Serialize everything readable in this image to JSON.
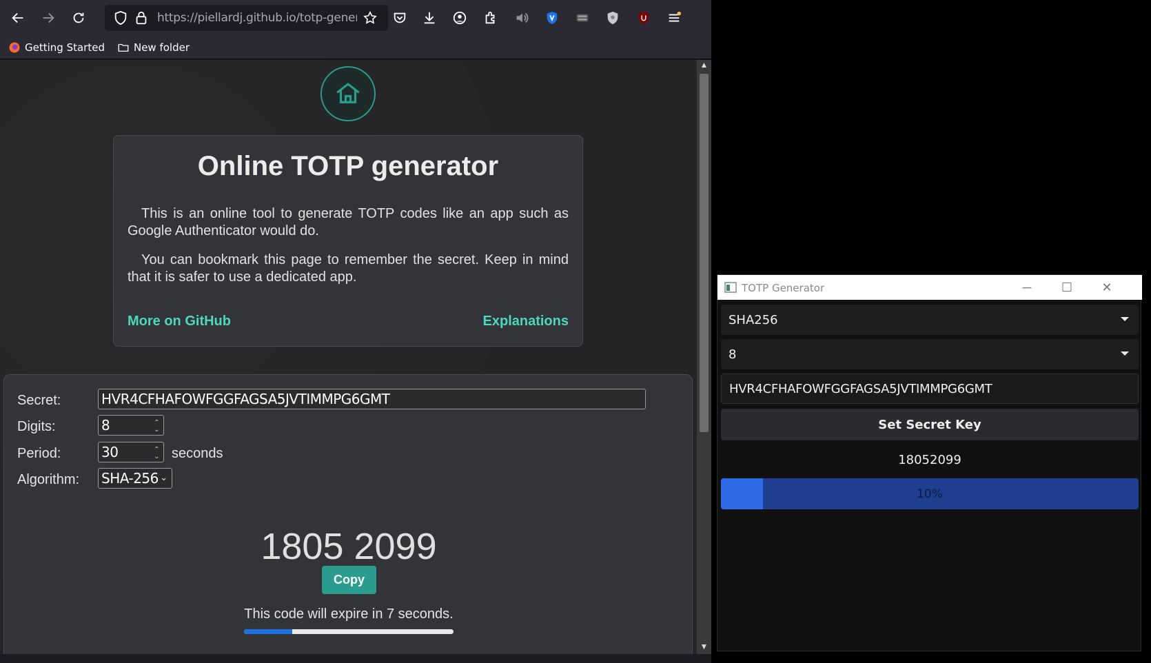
{
  "browser": {
    "url_host": "https://piellardj.github.io",
    "url_path": "/totp-generat",
    "bookmarks": [
      {
        "label": "Getting Started"
      },
      {
        "label": "New folder"
      }
    ]
  },
  "page": {
    "intro": {
      "title": "Online TOTP generator",
      "paragraph1": "This is an online tool to generate TOTP codes like an app such as Google Authenticator would do.",
      "paragraph2": "You can bookmark this page to remember the secret. Keep in mind that it is safer to use a dedicated app.",
      "github_link": "More on GitHub",
      "explanations_link": "Explanations"
    },
    "form": {
      "secret_label": "Secret:",
      "secret_value": "HVR4CFHAFOWFGGFAGSA5JVTIMMPG6GMT",
      "digits_label": "Digits:",
      "digits_value": "8",
      "period_label": "Period:",
      "period_value": "30",
      "period_unit": "seconds",
      "algorithm_label": "Algorithm:",
      "algorithm_value": "SHA-256"
    },
    "code": "1805 2099",
    "copy_label": "Copy",
    "expire_text": "This code will expire in 7 seconds.",
    "expire_progress_fraction": 0.23
  },
  "app": {
    "title": "TOTP Generator",
    "algorithm": "SHA256",
    "digits": "8",
    "secret": "HVR4CFHAFOWFGGFAGSA5JVTIMMPG6GMT",
    "set_button": "Set Secret Key",
    "code": "18052099",
    "progress_label": "10%",
    "progress_fraction": 0.1
  },
  "colors": {
    "accent_teal": "#2a9d8f",
    "link_teal": "#4fd6c0",
    "progress_blue": "#1e6fe0",
    "app_progress_bg": "#1f3e8f",
    "app_progress_fill": "#2f6be8"
  }
}
